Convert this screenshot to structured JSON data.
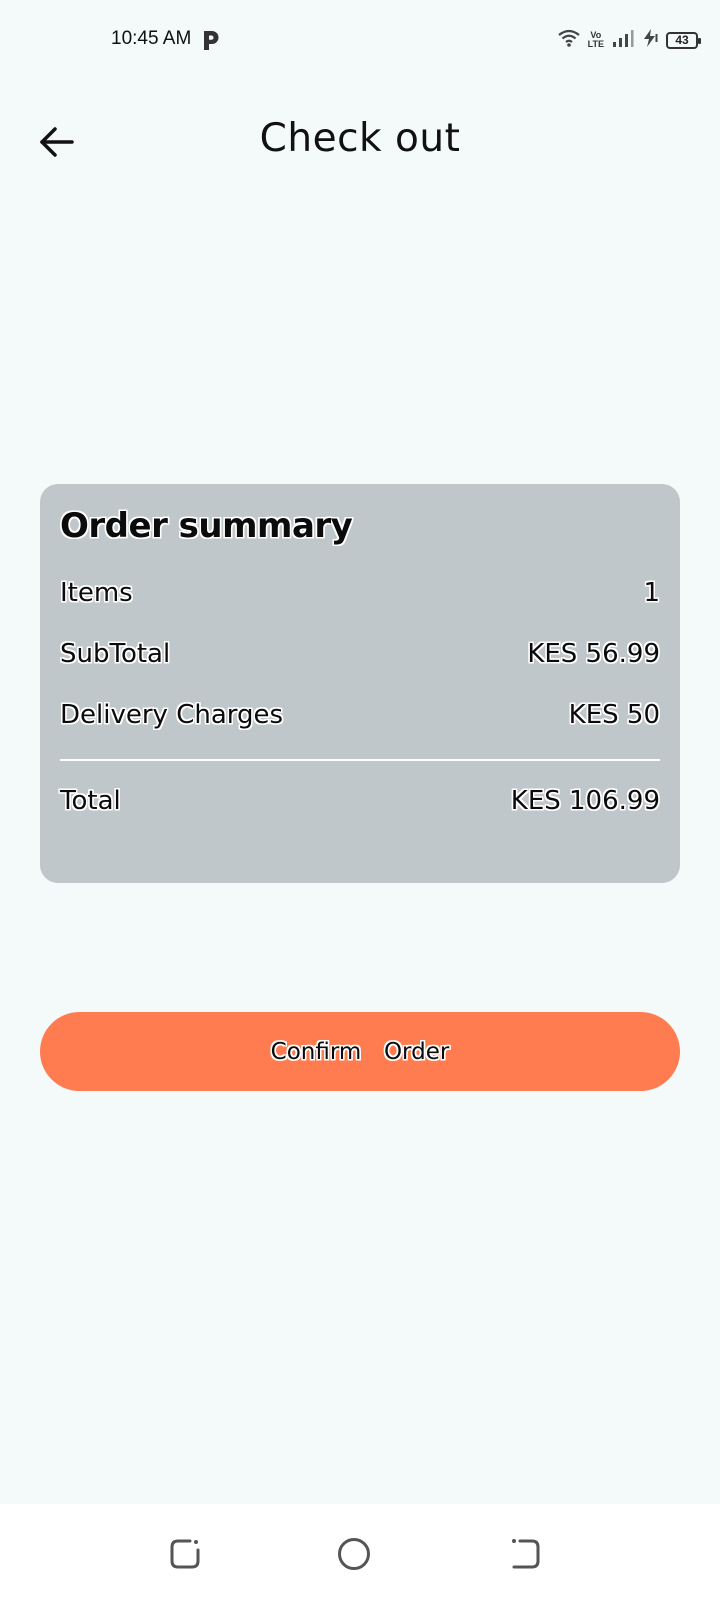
{
  "status_bar": {
    "time": "10:45 AM",
    "icons": [
      "parking-icon",
      "wifi-icon",
      "volte-icon",
      "signal-icon",
      "charging-icon",
      "battery-icon"
    ],
    "volte_top": "Vo",
    "volte_bottom": "LTE",
    "battery_level": "43"
  },
  "header": {
    "title": "Check out",
    "back_icon": "arrow-left-icon"
  },
  "order_summary": {
    "title": "Order summary",
    "rows": [
      {
        "label": "Items",
        "value": "1"
      },
      {
        "label": "SubTotal",
        "value": "KES 56.99"
      },
      {
        "label": "Delivery Charges",
        "value": "KES 50"
      }
    ],
    "total": {
      "label": "Total",
      "value": "KES 106.99"
    }
  },
  "confirm_button": {
    "label": "Confirm  Order"
  },
  "colors": {
    "background": "#f4f9f9",
    "card": "#c0c7ca",
    "accent": "#ff7b50"
  },
  "nav_bar": {
    "icons": [
      "recents-icon",
      "home-icon",
      "back-nav-icon"
    ]
  }
}
